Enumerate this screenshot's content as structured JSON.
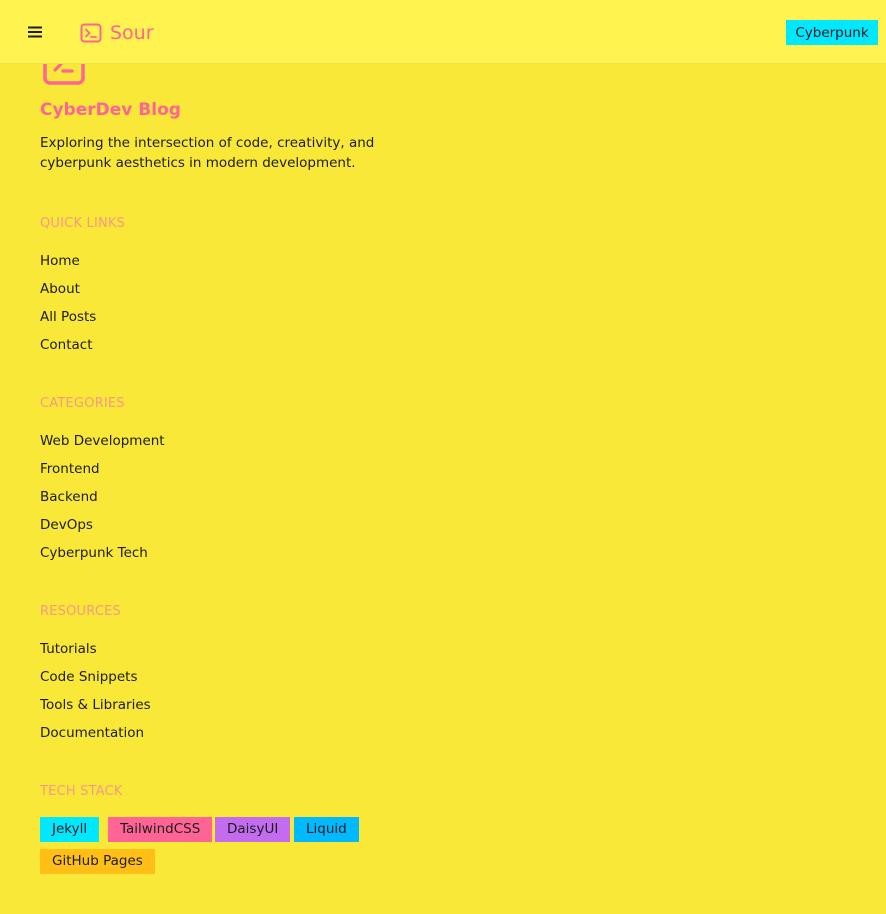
{
  "navbar": {
    "menu_icon": "hamburger-menu-icon",
    "brand_icon": "terminal-icon",
    "brand_name": "Sour",
    "theme_label": "Cyberpunk"
  },
  "footer": {
    "logo_icon": "terminal-icon",
    "title": "CyberDev Blog",
    "description": "Exploring the intersection of code, creativity, and cyberpunk aesthetics in modern development.",
    "sections": [
      {
        "title": "QUICK LINKS",
        "links": [
          "Home",
          "About",
          "All Posts",
          "Contact"
        ]
      },
      {
        "title": "CATEGORIES",
        "links": [
          "Web Development",
          "Frontend",
          "Backend",
          "DevOps",
          "Cyberpunk Tech"
        ]
      },
      {
        "title": "RESOURCES",
        "links": [
          "Tutorials",
          "Code Snippets",
          "Tools & Libraries",
          "Documentation"
        ]
      }
    ],
    "tech_stack": {
      "title": "TECH STACK",
      "tags": [
        {
          "label": "Jekyll",
          "color": "#00e8ff"
        },
        {
          "label": "TailwindCSS",
          "color": "#ff6496"
        },
        {
          "label": "DaisyUI",
          "color": "#c46cf0"
        },
        {
          "label": "Liquid",
          "color": "#00b9ff"
        },
        {
          "label": "GitHub Pages",
          "color": "#ffbf16"
        }
      ]
    }
  },
  "colors": {
    "background": "#f9e838",
    "navbar": "#fff34f",
    "accent_pink": "#ff6496",
    "section_heading": "#f59a85",
    "theme_button": "#00e8ff"
  }
}
